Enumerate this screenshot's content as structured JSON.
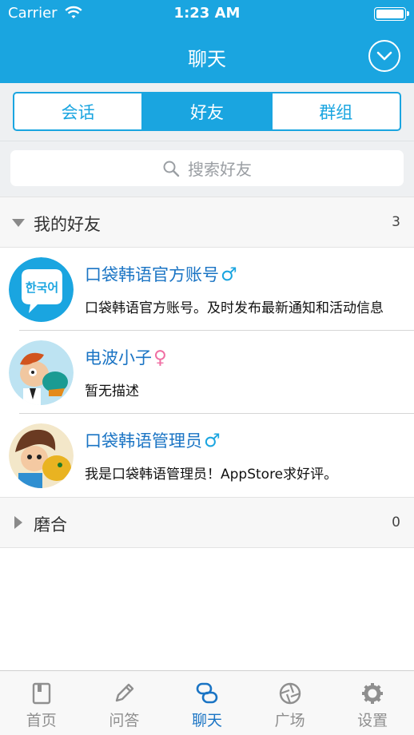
{
  "status_bar": {
    "carrier": "Carrier",
    "time": "1:23 AM"
  },
  "nav": {
    "title": "聊天"
  },
  "segments": [
    {
      "label": "会话",
      "active": false
    },
    {
      "label": "好友",
      "active": true
    },
    {
      "label": "群组",
      "active": false
    }
  ],
  "search": {
    "placeholder": "搜索好友"
  },
  "groups": [
    {
      "name": "我的好友",
      "count": "3",
      "expanded": true
    },
    {
      "name": "磨合",
      "count": "0",
      "expanded": false
    }
  ],
  "friends": [
    {
      "name": "口袋韩语官方账号",
      "gender": "♂",
      "gender_color": "#1aa5e0",
      "desc": "口袋韩语官方账号。及时发布最新通知和活动信息",
      "avatar_text": "한국어"
    },
    {
      "name": "电波小子",
      "gender": "♀",
      "gender_color": "#f06fa3",
      "desc": "暂无描述"
    },
    {
      "name": "口袋韩语管理员",
      "gender": "♂",
      "gender_color": "#1aa5e0",
      "desc": "我是口袋韩语管理员！AppStore求好评。"
    }
  ],
  "tabs": [
    {
      "label": "首页",
      "icon": "book-icon",
      "active": false
    },
    {
      "label": "问答",
      "icon": "pencil-icon",
      "active": false
    },
    {
      "label": "聊天",
      "icon": "chat-icon",
      "active": true
    },
    {
      "label": "广场",
      "icon": "aperture-icon",
      "active": false
    },
    {
      "label": "设置",
      "icon": "gear-icon",
      "active": false
    }
  ],
  "colors": {
    "accent": "#1aa5e0",
    "link": "#1a74c4",
    "female": "#f06fa3",
    "tab_inactive": "#8f8f8f"
  }
}
